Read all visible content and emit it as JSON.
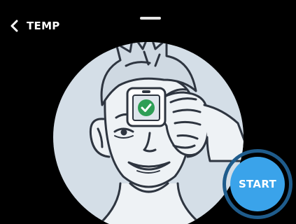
{
  "header": {
    "back_icon": "chevron-left-icon",
    "title": "TEMP"
  },
  "illustration": {
    "subject": "face-with-device-on-forehead",
    "device_status_icon": "check-circle-icon"
  },
  "start_button": {
    "label": "START"
  },
  "colors": {
    "background": "#000000",
    "circle_fill": "#d4dee7",
    "line_art": "#2e3540",
    "accent_blue": "#3aa3ea",
    "ring_blue": "#1f5c8c",
    "check_green": "#2e9e55"
  }
}
